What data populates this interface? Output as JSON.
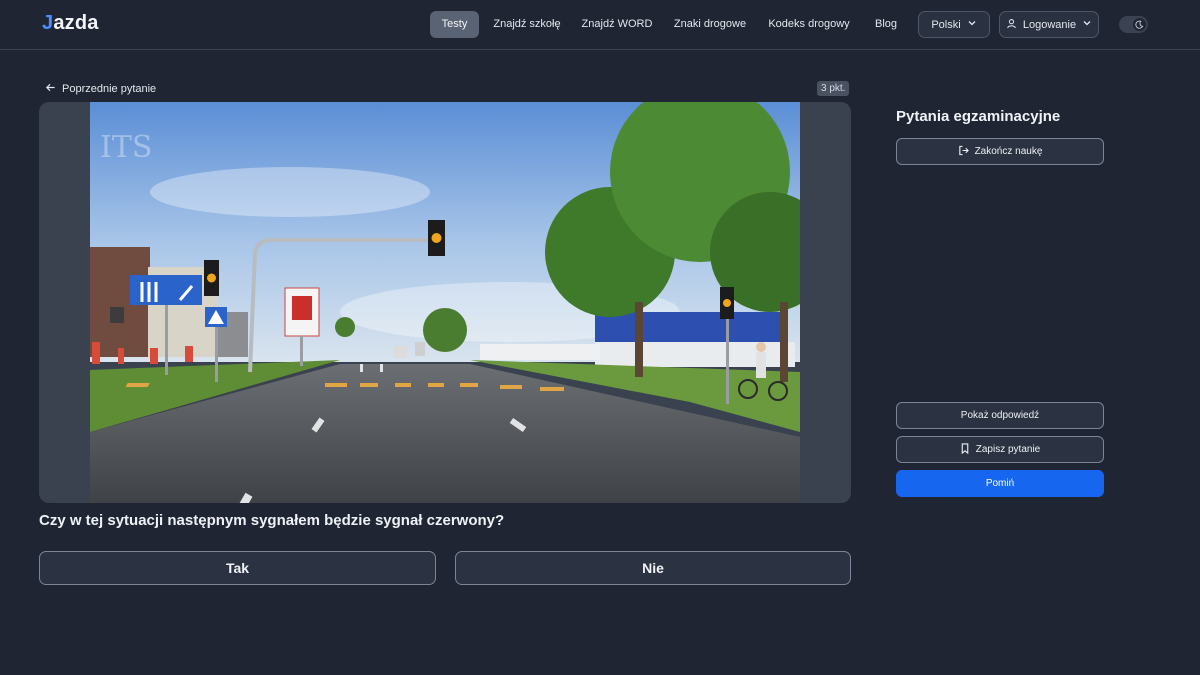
{
  "brand": {
    "logo_mark": "J",
    "logo_text": "azda"
  },
  "nav": {
    "items": [
      {
        "label": "Testy"
      },
      {
        "label": "Znajdź szkołę"
      },
      {
        "label": "Znajdź WORD"
      },
      {
        "label": "Znaki drogowe"
      },
      {
        "label": "Kodeks drogowy"
      },
      {
        "label": "Blog"
      }
    ],
    "active_index": 0,
    "language": "Polski",
    "login": "Logowanie",
    "theme_toggle_icon": "moon-icon"
  },
  "question": {
    "prev_label": "Poprzednie pytanie",
    "points": "3 pkt.",
    "text": "Czy w tej sytuacji następnym sygnałem będzie sygnał czerwony?",
    "answers": [
      "Tak",
      "Nie"
    ],
    "image_icon": "intersection-traffic-light-photo"
  },
  "sidebar": {
    "title": "Pytania egzaminacyjne",
    "finish_label": "Zakończ naukę",
    "show_answer_label": "Pokaż odpowiedź",
    "save_label": "Zapisz pytanie",
    "skip_label": "Pomiń"
  },
  "colors": {
    "background": "#1f2533",
    "accent": "#1766f0",
    "active_nav": "#5a6373"
  }
}
